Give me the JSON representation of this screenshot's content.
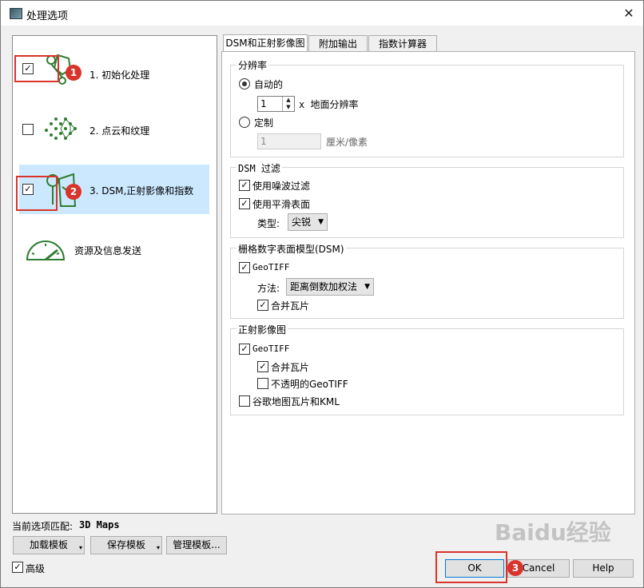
{
  "window": {
    "title": "处理选项",
    "close_icon": "close-icon"
  },
  "steps": [
    {
      "label": "1. 初始化处理",
      "checked": true,
      "badge": "1"
    },
    {
      "label": "2. 点云和纹理",
      "checked": false
    },
    {
      "label": "3. DSM,正射影像和指数",
      "checked": true,
      "badge": "2"
    },
    {
      "label": "资源及信息发送"
    }
  ],
  "tabs": [
    "DSM和正射影像图",
    "附加输出",
    "指数计算器"
  ],
  "resolution": {
    "group_label": "分辨率",
    "auto_label": "自动的",
    "auto_value": "1",
    "auto_unit": "x 地面分辨率",
    "custom_label": "定制",
    "custom_value": "1",
    "custom_unit": "厘米/像素"
  },
  "dsm_filter": {
    "group_label": "DSM 过滤",
    "noise_label": "使用噪波过滤",
    "smooth_label": "使用平滑表面",
    "type_label": "类型:",
    "type_value": "尖锐"
  },
  "raster_dsm": {
    "group_label": "栅格数字表面模型(DSM)",
    "geotiff_label": "GeoTIFF",
    "method_label": "方法:",
    "method_value": "距离倒数加权法",
    "merge_label": "合并瓦片"
  },
  "ortho": {
    "group_label": "正射影像图",
    "geotiff_label": "GeoTIFF",
    "merge_label": "合并瓦片",
    "opaque_label": "不透明的GeoTIFF",
    "kml_label": "谷歌地图瓦片和KML"
  },
  "footer": {
    "match_label": "当前选项匹配:",
    "match_value": "3D Maps",
    "load_template": "加载模板",
    "save_template": "保存模板",
    "manage_template": "管理模板...",
    "advanced_label": "高级",
    "ok": "OK",
    "cancel": "Cancel",
    "help": "Help",
    "badge3": "3"
  },
  "watermark": "Baidu经验"
}
